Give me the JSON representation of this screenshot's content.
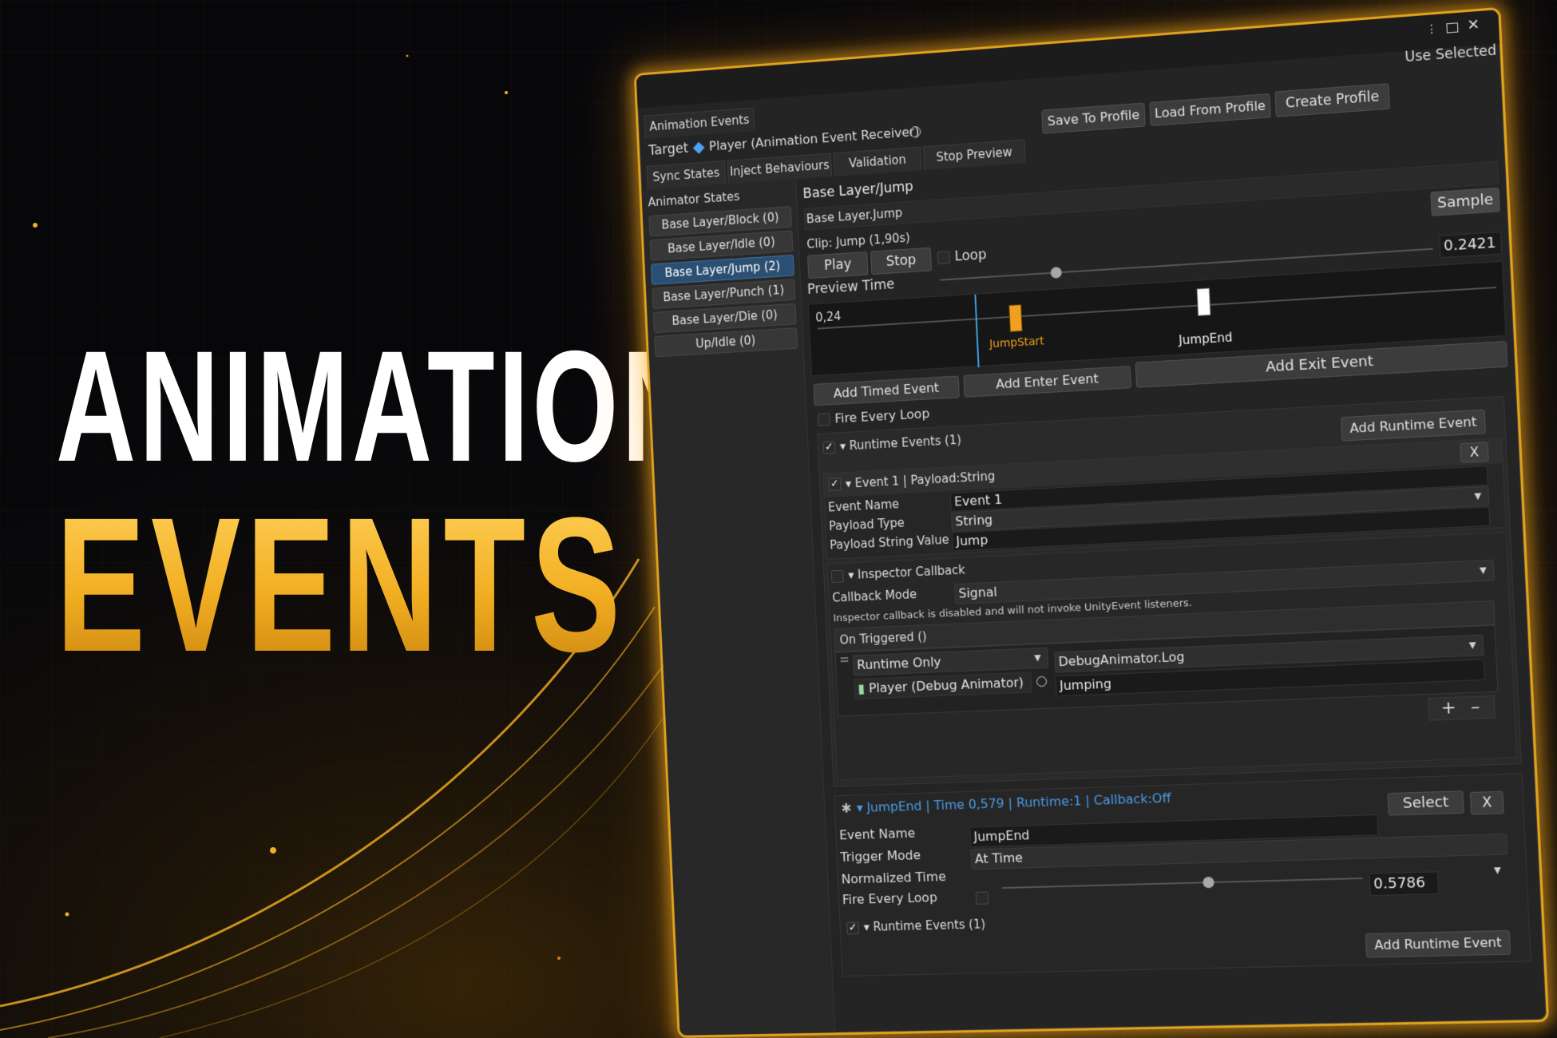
{
  "hero": {
    "line1": "ANIMATION",
    "line2": "EVENTS"
  },
  "colors": {
    "accent_gold": "#f2ae22",
    "window_bg": "#242424",
    "selection_blue": "#2b4f73",
    "event_blue": "#4a9be8",
    "marker_orange": "#f0a01e"
  },
  "window": {
    "tab_title": "Animation Events",
    "use_selected": "Use Selected",
    "controls": {
      "menu_icon": "kebab-menu-icon",
      "maximize_icon": "maximize-icon",
      "close_icon": "close-icon"
    },
    "target": {
      "label": "Target",
      "value": "Player (Animation Event Receiver)",
      "object_icon": "diamond-icon",
      "picker_icon": "object-picker-icon"
    },
    "profile_buttons": {
      "save": "Save To Profile",
      "load": "Load From Profile",
      "create": "Create Profile"
    },
    "tabs": [
      "Sync States",
      "Inject Behaviours",
      "Validation",
      "Stop Preview"
    ]
  },
  "sidebar": {
    "title": "Animator States",
    "states": [
      {
        "label": "Base Layer/Block (0)",
        "selected": false
      },
      {
        "label": "Base Layer/Idle (0)",
        "selected": false
      },
      {
        "label": "Base Layer/Jump (2)",
        "selected": true
      },
      {
        "label": "Base Layer/Punch (1)",
        "selected": false
      },
      {
        "label": "Base Layer/Die (0)",
        "selected": false
      },
      {
        "label": "Up/Idle (0)",
        "selected": false
      }
    ]
  },
  "main": {
    "heading": "Base Layer/Jump",
    "state_path": "Base Layer.Jump",
    "clip_info": "Clip: Jump (1,90s)",
    "sample_button": "Sample",
    "play_button": "Play",
    "stop_button": "Stop",
    "loop_label": "Loop",
    "loop_checked": false,
    "preview_time_label": "Preview Time",
    "preview_time_value": "0.2421",
    "preview_time_fraction": 0.24,
    "timeline": {
      "cursor_label": "0,24",
      "cursor_fraction": 0.24,
      "markers": [
        {
          "label": "JumpStart",
          "fraction": 0.3,
          "color": "#f0a01e"
        },
        {
          "label": "JumpEnd",
          "fraction": 0.579,
          "color": "#ffffff"
        }
      ]
    },
    "add_buttons": {
      "timed": "Add Timed Event",
      "enter": "Add Enter Event",
      "exit": "Add Exit Event"
    },
    "fire_every_loop_label": "Fire Every Loop",
    "runtime_events": {
      "header": "Runtime Events (1)",
      "add_button": "Add Runtime Event",
      "event": {
        "header": "Event 1 | Payload:String",
        "remove_label": "X",
        "fields": [
          {
            "label": "Event Name",
            "value": "Event 1",
            "kind": "text"
          },
          {
            "label": "Payload Type",
            "value": "String",
            "kind": "dropdown"
          },
          {
            "label": "Payload String Value",
            "value": "Jump",
            "kind": "text"
          }
        ]
      }
    },
    "inspector_callback": {
      "header": "Inspector Callback",
      "mode_label": "Callback Mode",
      "mode_value": "Signal",
      "warning": "Inspector callback is disabled and will not invoke UnityEvent listeners.",
      "unity_event_header": "On Triggered ()",
      "listener": {
        "runtime_mode": "Runtime Only",
        "object": "Player (Debug Animator)",
        "function": "DebugAnimator.Log",
        "argument": "Jumping"
      },
      "add_icon": "+",
      "remove_icon": "–"
    },
    "jump_end_event": {
      "header": "JumpEnd | Time 0,579 | Runtime:1 | Callback:Off",
      "select_button": "Select",
      "remove_label": "X",
      "event_name_label": "Event Name",
      "event_name_value": "JumpEnd",
      "trigger_mode_label": "Trigger Mode",
      "trigger_mode_value": "At Time",
      "normalized_time_label": "Normalized Time",
      "normalized_time_value": "0.5786",
      "normalized_time_fraction": 0.5786,
      "fire_every_loop_label": "Fire Every Loop",
      "runtime_events_header": "Runtime Events (1)",
      "add_runtime_button": "Add Runtime Event"
    }
  }
}
